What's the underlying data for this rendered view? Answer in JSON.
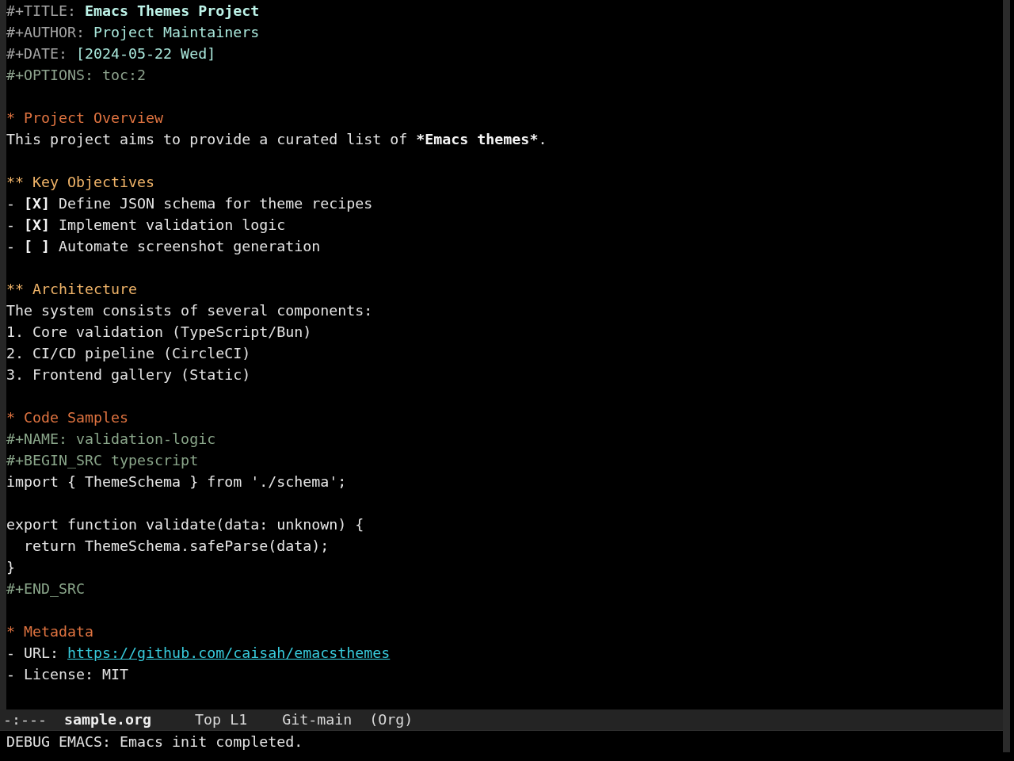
{
  "buffer": {
    "lines": [
      {
        "kind": "title",
        "key": "#+TITLE:",
        "value": "Emacs Themes Project"
      },
      {
        "kind": "keyword",
        "key": "#+AUTHOR:",
        "value": "Project Maintainers"
      },
      {
        "kind": "keyword",
        "key": "#+DATE:",
        "value": "[2024-05-22 Wed]"
      },
      {
        "kind": "setting",
        "text": "#+OPTIONS: toc:2"
      },
      {
        "kind": "blank"
      },
      {
        "kind": "heading",
        "text": "* Project Overview"
      },
      {
        "kind": "text",
        "segments": [
          {
            "text": "This project aims to provide a curated list of ",
            "bold": false
          },
          {
            "text": "*Emacs themes*",
            "bold": true
          },
          {
            "text": ".",
            "bold": false
          }
        ]
      },
      {
        "kind": "blank"
      },
      {
        "kind": "subheading",
        "text": "** Key Objectives"
      },
      {
        "kind": "checkbox",
        "segments": [
          {
            "text": "- ",
            "bold": false
          },
          {
            "text": "[X]",
            "bold": true
          },
          {
            "text": " Define JSON schema for theme recipes",
            "bold": false
          }
        ]
      },
      {
        "kind": "checkbox",
        "segments": [
          {
            "text": "- ",
            "bold": false
          },
          {
            "text": "[X]",
            "bold": true
          },
          {
            "text": " Implement validation logic",
            "bold": false
          }
        ]
      },
      {
        "kind": "checkbox",
        "segments": [
          {
            "text": "- ",
            "bold": false
          },
          {
            "text": "[ ]",
            "bold": true
          },
          {
            "text": " Automate screenshot generation",
            "bold": false
          }
        ]
      },
      {
        "kind": "blank"
      },
      {
        "kind": "subheading",
        "text": "** Architecture"
      },
      {
        "kind": "text",
        "segments": [
          {
            "text": "The system consists of several components:",
            "bold": false
          }
        ]
      },
      {
        "kind": "list",
        "segments": [
          {
            "text": "1. Core validation (TypeScript/Bun)",
            "bold": false
          }
        ]
      },
      {
        "kind": "list",
        "segments": [
          {
            "text": "2. CI/CD pipeline (CircleCI)",
            "bold": false
          }
        ]
      },
      {
        "kind": "list",
        "segments": [
          {
            "text": "3. Frontend gallery (Static)",
            "bold": false
          }
        ]
      },
      {
        "kind": "blank"
      },
      {
        "kind": "heading",
        "text": "* Code Samples"
      },
      {
        "kind": "directive",
        "text": "#+NAME: validation-logic"
      },
      {
        "kind": "directive",
        "text": "#+BEGIN_SRC typescript"
      },
      {
        "kind": "code",
        "text": "import { ThemeSchema } from './schema';"
      },
      {
        "kind": "blank"
      },
      {
        "kind": "code",
        "text": "export function validate(data: unknown) {"
      },
      {
        "kind": "code",
        "text": "  return ThemeSchema.safeParse(data);"
      },
      {
        "kind": "code",
        "text": "}"
      },
      {
        "kind": "directive",
        "text": "#+END_SRC"
      },
      {
        "kind": "blank"
      },
      {
        "kind": "heading",
        "text": "* Metadata"
      },
      {
        "kind": "link_item",
        "label": "- URL: ",
        "link": "https://github.com/caisah/emacsthemes"
      },
      {
        "kind": "list",
        "segments": [
          {
            "text": "- License: MIT",
            "bold": false
          }
        ]
      }
    ]
  },
  "mode_line": {
    "items": [
      {
        "kind": "status",
        "text": "-:---"
      },
      {
        "kind": "buffer_name",
        "text": "sample.org"
      },
      {
        "kind": "position",
        "text": "Top L1"
      },
      {
        "kind": "vc",
        "text": "Git-main"
      },
      {
        "kind": "mode",
        "text": "(Org)"
      }
    ]
  },
  "echo_area": {
    "message": "DEBUG EMACS: Emacs init completed."
  }
}
